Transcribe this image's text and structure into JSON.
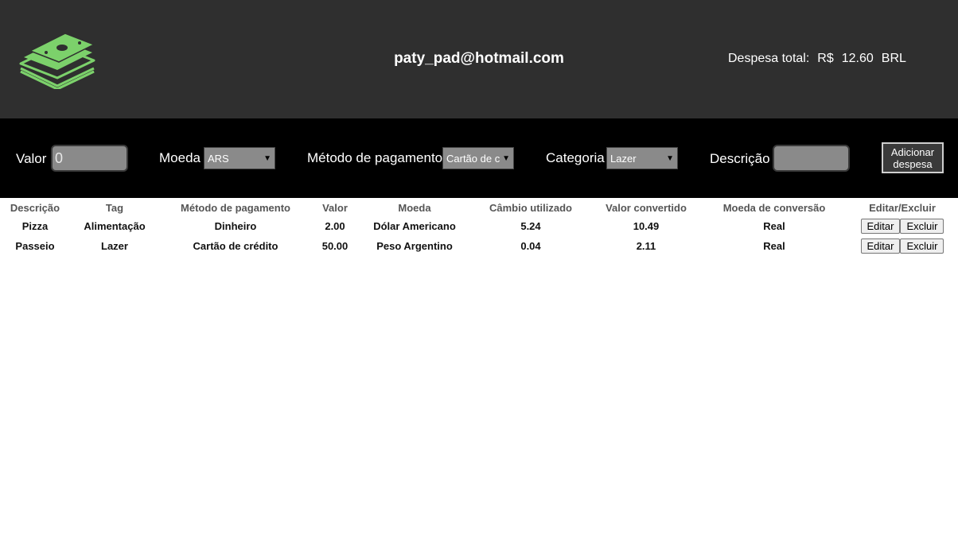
{
  "header": {
    "email": "paty_pad@hotmail.com",
    "total_label": "Despesa total:",
    "currency_symbol": "R$",
    "total_value": "12.60",
    "currency_code": "BRL",
    "logo_icon": "money-stack-icon",
    "logo_color": "#7cd16b"
  },
  "form": {
    "valor_label": "Valor",
    "valor_value": "0",
    "moeda_label": "Moeda",
    "moeda_selected": "ARS",
    "metodo_label": "Método de pagamento",
    "metodo_selected": "Cartão de c",
    "categoria_label": "Categoria",
    "categoria_selected": "Lazer",
    "descricao_label": "Descrição",
    "descricao_value": "",
    "add_button": "Adicionar despesa"
  },
  "table": {
    "headers": [
      "Descrição",
      "Tag",
      "Método de pagamento",
      "Valor",
      "Moeda",
      "Câmbio utilizado",
      "Valor convertido",
      "Moeda de conversão",
      "Editar/Excluir"
    ],
    "rows": [
      {
        "descricao": "Pizza",
        "tag": "Alimentação",
        "metodo": "Dinheiro",
        "valor": "2.00",
        "moeda": "Dólar Americano",
        "cambio": "5.24",
        "convertido": "10.49",
        "moeda_conversao": "Real",
        "edit": "Editar",
        "delete": "Excluir"
      },
      {
        "descricao": "Passeio",
        "tag": "Lazer",
        "metodo": "Cartão de crédito",
        "valor": "50.00",
        "moeda": "Peso Argentino",
        "cambio": "0.04",
        "convertido": "2.11",
        "moeda_conversao": "Real",
        "edit": "Editar",
        "delete": "Excluir"
      }
    ]
  }
}
